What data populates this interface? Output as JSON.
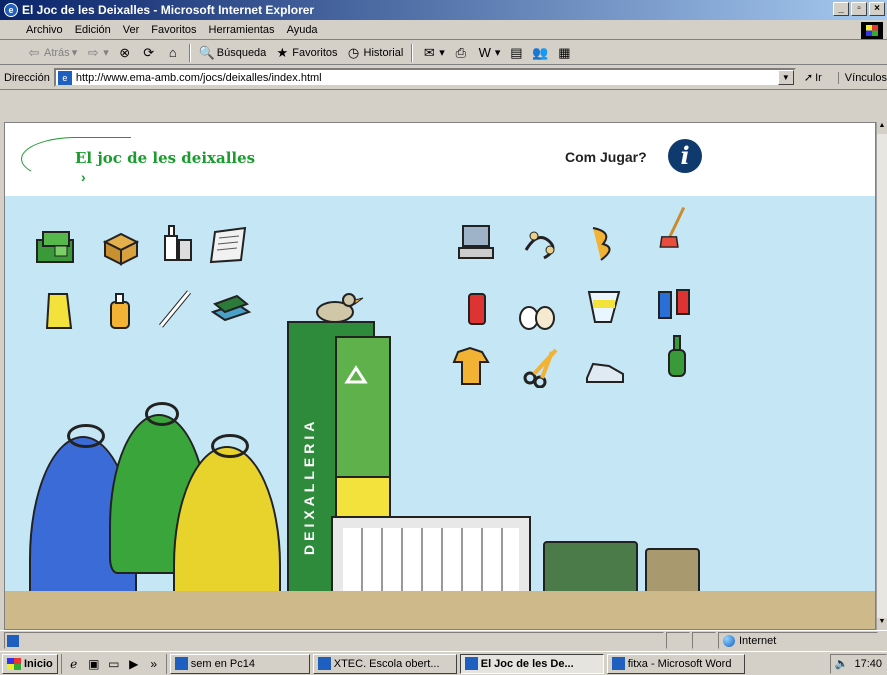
{
  "window": {
    "title": "El Joc de les Deixalles - Microsoft Internet Explorer"
  },
  "menu": [
    "Archivo",
    "Edición",
    "Ver",
    "Favoritos",
    "Herramientas",
    "Ayuda"
  ],
  "toolbar": {
    "back": "Atrás",
    "search": "Búsqueda",
    "favorites": "Favoritos",
    "history": "Historial"
  },
  "address": {
    "label": "Dirección",
    "url": "http://www.ema-amb.com/jocs/deixalles/index.html",
    "go": "Ir",
    "links": "Vínculos"
  },
  "game": {
    "title": "El joc de les deixalles",
    "howto": "Com Jugar?",
    "info_glyph": "i",
    "deixalleria_label": "DEIXALLERIA"
  },
  "status": {
    "zone": "Internet"
  },
  "taskbar": {
    "start": "Inicio",
    "tasks": [
      {
        "label": "sem en Pc14",
        "active": false
      },
      {
        "label": "XTEC. Escola obert...",
        "active": false
      },
      {
        "label": "El Joc de les De...",
        "active": true
      },
      {
        "label": "fitxa - Microsoft Word",
        "active": false
      }
    ],
    "clock": "17:40",
    "more": "»"
  },
  "colors": {
    "sky": "#c5e6f5",
    "floor": "#cdb98a",
    "accent_green": "#1a9c2e"
  }
}
